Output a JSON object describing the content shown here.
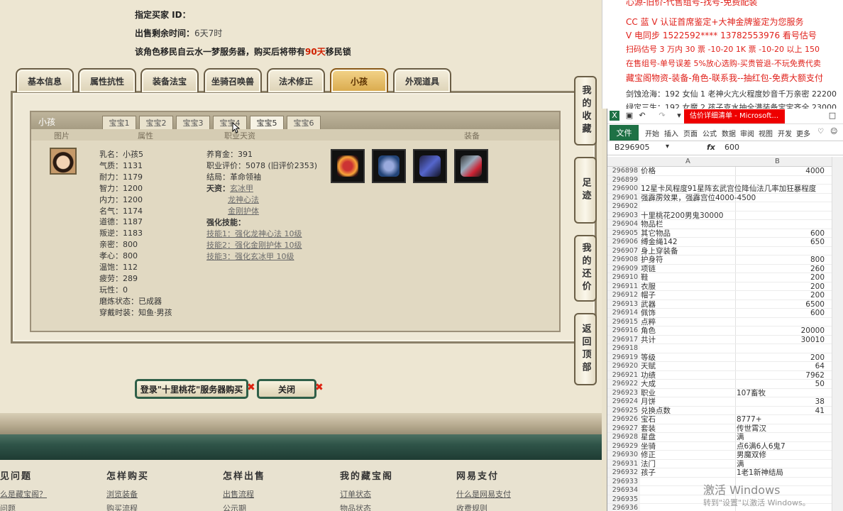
{
  "seller": {
    "buyer_id_label": "指定买家 ID：",
    "time_label": "出售剩余时间：",
    "time_value": "6天7时",
    "migrate_text_pre": "该角色移民自云水一梦服务器，购买后将带有",
    "migrate_days": "90天",
    "migrate_text_post": "移民锁"
  },
  "tabs": [
    "基本信息",
    "属性抗性",
    "装备法宝",
    "坐骑召唤兽",
    "法术修正",
    "小孩",
    "外观道具"
  ],
  "active_tab": "小孩",
  "child_panel": {
    "title": "小孩",
    "subtabs": [
      "宝宝1",
      "宝宝2",
      "宝宝3",
      "宝宝4",
      "宝宝5",
      "宝宝6"
    ],
    "active_subtab": "宝宝5",
    "col_headers": [
      "图片",
      "属性",
      "职业天资",
      "装备"
    ],
    "attrs": [
      "乳名：小孩5",
      "气质：1131",
      "耐力：1179",
      "智力：1200",
      "内力：1200",
      "名气：1174",
      "道德：1187",
      "叛逆：1183",
      "亲密：800",
      "孝心：800",
      "温饱：112",
      "疲劳：289",
      "玩性：0",
      "磨炼状态：已成器",
      "穿戴时装：知鱼·男孩"
    ],
    "mid": {
      "edu": "养育金：391",
      "rating": "职业评价：5078 (旧评价2353)",
      "ending": "结局：革命领袖",
      "talent_label": "天资：",
      "talents": [
        "玄冰甲",
        "龙神心法",
        "金刚护体"
      ],
      "skill_label": "强化技能：",
      "skills": [
        "技能1：强化龙神心法 10级",
        "技能2：强化金刚护体 10级",
        "技能3：强化玄冰甲 10级"
      ]
    }
  },
  "side_nav": [
    "我的收藏",
    "足迹",
    "我的还价",
    "返回顶部"
  ],
  "buttons": {
    "buy": "登录\"十里桃花\"服务器购买",
    "close": "关闭"
  },
  "footer": [
    {
      "title": "见问题",
      "links": [
        "么是藏宝阁？",
        "问题"
      ]
    },
    {
      "title": "怎样购买",
      "links": [
        "浏览装备",
        "购买流程"
      ]
    },
    {
      "title": "怎样出售",
      "links": [
        "出售流程",
        "公示期"
      ]
    },
    {
      "title": "我的藏宝阁",
      "links": [
        "订单状态",
        "物品状态"
      ]
    },
    {
      "title": "网易支付",
      "links": [
        "什么是网易支付",
        "收费规则"
      ]
    }
  ],
  "ads": [
    {
      "text": "心源-旧价-代售组号-找号-免费配装",
      "color": "#e0201a"
    },
    {
      "text": "CC 蓝 V 认证首席鉴定+大神金牌鉴定为您服务",
      "color": "#e0201a"
    },
    {
      "text": "V 电同步 1522592**** 13782553976 看号估号",
      "color": "#e0201a"
    },
    {
      "text": "扫码估号 3 万内 30 票 -10-20 1K 票 -10-20 以上 150",
      "color": "#e0201a"
    },
    {
      "text": "在售组号-单号误差 5%放心选购-买贵管退-不玩免费代卖",
      "color": "#e0201a"
    },
    {
      "text": "藏宝阁物资-装备-角色-联系我--抽红包-免费大额支付",
      "color": "#e0201a"
    },
    {
      "text": "剑蚀沧海：192 女仙 1 老神火亢火程度妙音千万亲密 22200",
      "color": "#333333"
    },
    {
      "text": "绿定三生：192 女魔 2 孩子克水抽全满装备宝宝齐全 23000",
      "color": "#333333"
    }
  ],
  "excel": {
    "doc_title": "估价详细清单 - Microsoft...",
    "ribbon": {
      "file": "文件",
      "tabs": [
        "开始",
        "插入",
        "页面",
        "公式",
        "数据",
        "审阅",
        "视图",
        "开发",
        "更多"
      ]
    },
    "name_box": "B296905",
    "fx": "fx",
    "formula": "600",
    "col_a": "A",
    "col_b": "B",
    "rows": [
      [
        "296898",
        "价格",
        "4000"
      ],
      [
        "296899",
        "",
        ""
      ],
      [
        "296900",
        "12星卡风程度91星阵玄武宫位降仙法几率加狂暴程度",
        ""
      ],
      [
        "296901",
        "强霹雳效果，强霹宫位4000-4500",
        ""
      ],
      [
        "296902",
        "",
        ""
      ],
      [
        "296903",
        "十里桃花200男鬼30000",
        ""
      ],
      [
        "296904",
        "物品栏",
        ""
      ],
      [
        "296905",
        "其它物品",
        "600"
      ],
      [
        "296906",
        "缚金绳142",
        "650"
      ],
      [
        "296907",
        "身上穿装备",
        ""
      ],
      [
        "296908",
        "护身符",
        "800"
      ],
      [
        "296909",
        "项链",
        "260"
      ],
      [
        "296910",
        "鞋",
        "200"
      ],
      [
        "296911",
        "衣服",
        "200"
      ],
      [
        "296912",
        "帽子",
        "200"
      ],
      [
        "296913",
        "武器",
        "6500"
      ],
      [
        "296914",
        "佩饰",
        "600"
      ],
      [
        "296915",
        "点粹",
        ""
      ],
      [
        "296916",
        "角色",
        "20000"
      ],
      [
        "296917",
        "共计",
        "30010"
      ],
      [
        "296918",
        "",
        ""
      ],
      [
        "296919",
        "等级",
        "200"
      ],
      [
        "296920",
        "天赋",
        "64"
      ],
      [
        "296921",
        "功绩",
        "7962"
      ],
      [
        "296922",
        "大成",
        "50"
      ],
      [
        "296923",
        "职业",
        "107畜牧"
      ],
      [
        "296924",
        "月饼",
        "38"
      ],
      [
        "296925",
        "兑换点数",
        "41"
      ],
      [
        "296926",
        "宝石",
        "8777+"
      ],
      [
        "296927",
        "套装",
        "传世霄汉"
      ],
      [
        "296928",
        "星盘",
        "满"
      ],
      [
        "296929",
        "坐骑",
        "点6满6人6鬼7"
      ],
      [
        "296930",
        "修正",
        "男魔双修"
      ],
      [
        "296931",
        "法门",
        "满"
      ],
      [
        "296932",
        "孩子",
        "1老1新神结局"
      ],
      [
        "296933",
        "",
        ""
      ],
      [
        "296934",
        "",
        ""
      ],
      [
        "296935",
        "",
        ""
      ],
      [
        "296936",
        "",
        ""
      ]
    ],
    "watermark": "激活 Windows",
    "watermark_sub": "转到\"设置\"以激活 Windows。"
  }
}
